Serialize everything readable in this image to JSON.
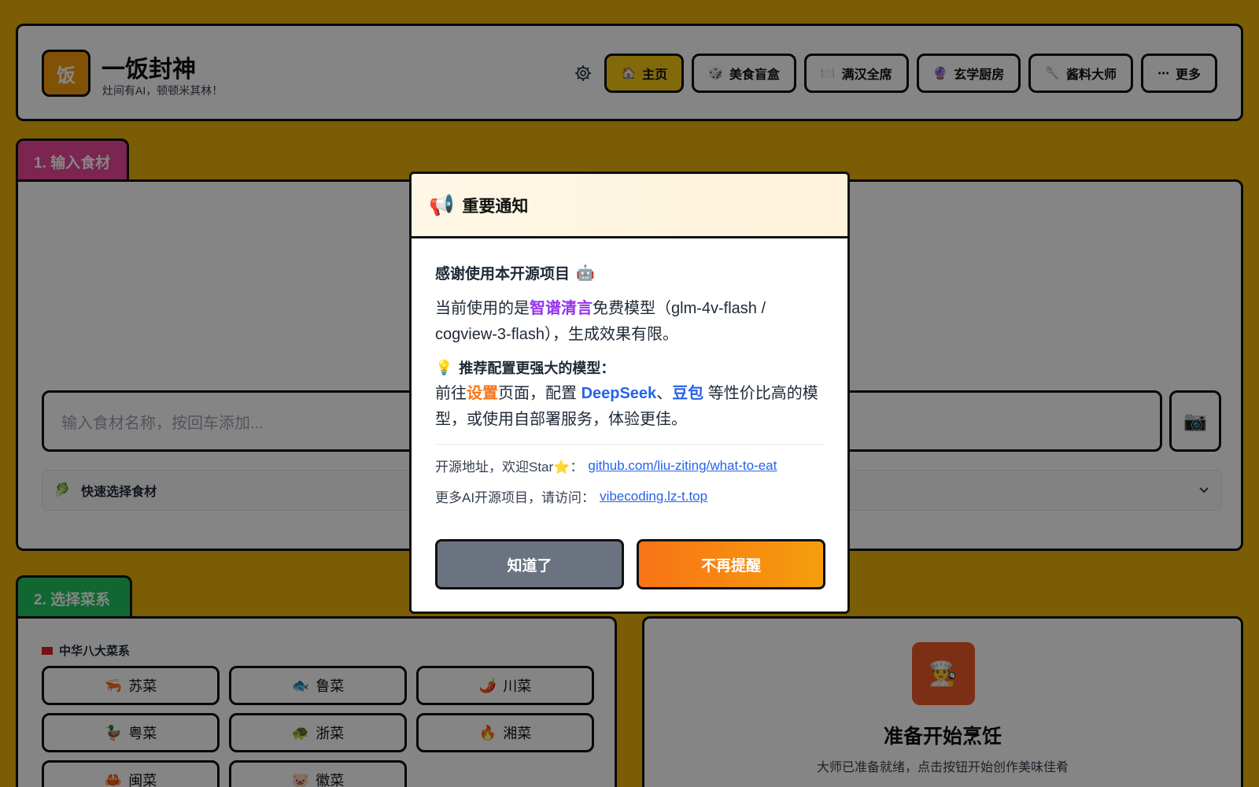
{
  "header": {
    "logo_text": "饭",
    "title": "一饭封神",
    "subtitle": "灶间有AI，顿顿米其林！",
    "settings_icon": "gear-icon",
    "nav": [
      {
        "icon": "🏠",
        "label": "主页",
        "active": true
      },
      {
        "icon": "🎲",
        "label": "美食盲盒"
      },
      {
        "icon": "🍽️",
        "label": "满汉全席"
      },
      {
        "icon": "🔮",
        "label": "玄学厨房"
      },
      {
        "icon": "🥄",
        "label": "酱料大师"
      },
      {
        "icon": "⋯",
        "label": "更多"
      }
    ]
  },
  "section1": {
    "tab": "1. 输入食材",
    "input_placeholder": "输入食材名称，按回车添加...",
    "camera_icon": "📷",
    "quick_label": "快速选择食材",
    "quick_icon": "🥬"
  },
  "section2": {
    "tab": "2. 选择菜系",
    "cuisine_heading": "中华八大菜系",
    "cuisines": [
      {
        "icon": "🦐",
        "label": "苏菜"
      },
      {
        "icon": "🐟",
        "label": "鲁菜"
      },
      {
        "icon": "🌶️",
        "label": "川菜"
      },
      {
        "icon": "🦆",
        "label": "粤菜"
      },
      {
        "icon": "🐢",
        "label": "浙菜"
      },
      {
        "icon": "🔥",
        "label": "湘菜"
      },
      {
        "icon": "🦀",
        "label": "闽菜"
      },
      {
        "icon": "🐷",
        "label": "徽菜"
      }
    ]
  },
  "ready": {
    "icon": "👨‍🍳",
    "title": "准备开始烹饪",
    "subtitle": "大师已准备就绪，点击按钮开始创作美味佳肴"
  },
  "modal": {
    "icon": "📢",
    "title": "重要通知",
    "thanks": "感谢使用本开源项目",
    "thanks_icon": "🤖",
    "p1_prefix": "当前使用的是",
    "p1_highlight": "智谱清言",
    "p1_suffix": "免费模型（glm-4v-flash / cogview-3-flash），生成效果有限。",
    "rec_icon": "💡",
    "rec_title": "推荐配置更强大的模型：",
    "rec_a": "前往",
    "rec_settings": "设置",
    "rec_b": "页面，配置 ",
    "rec_deepseek": "DeepSeek",
    "rec_sep": "、",
    "rec_doubao": "豆包",
    "rec_c": " 等性价比高的模型，或使用自部署服务，体验更佳。",
    "repo_label": "开源地址，欢迎Star⭐：",
    "repo_link": "github.com/liu-ziting/what-to-eat",
    "more_label": "更多AI开源项目，请访问：",
    "more_link": "vibecoding.lz-t.top",
    "btn_ok": "知道了",
    "btn_never": "不再提醒"
  }
}
